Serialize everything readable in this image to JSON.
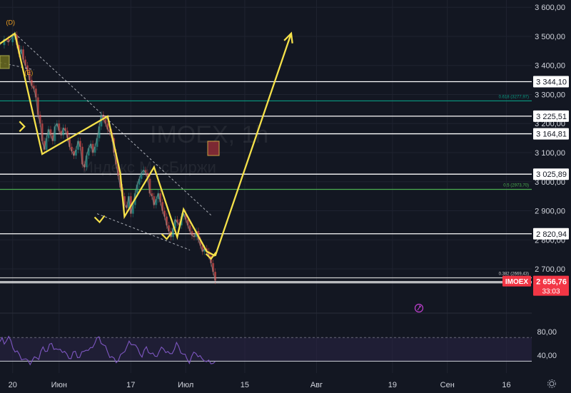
{
  "chart_data": {
    "type": "line",
    "watermark": {
      "ticker": "IMOEX, 1h",
      "name": "Индекс МосБиржи"
    },
    "price_axis": {
      "range": [
        2575,
        3625
      ],
      "ticks": [
        "3 600,00",
        "3 500,00",
        "3 400,00",
        "3 300,00",
        "3 200,00",
        "3 100,00",
        "3 000,00",
        "2 900,00",
        "2 800,00",
        "2 700,00"
      ],
      "tick_values": [
        3600,
        3500,
        3400,
        3300,
        3200,
        3100,
        3000,
        2900,
        2800,
        2700
      ]
    },
    "time_axis": {
      "labels": [
        "20",
        "Июн",
        "17",
        "Июл",
        "15",
        "Авг",
        "19",
        "Сен",
        "16"
      ],
      "label_days": [
        0,
        11,
        28,
        41,
        55,
        72,
        90,
        103,
        117
      ],
      "range_days": [
        -3,
        123
      ]
    },
    "levels": [
      {
        "value": 3344.1,
        "label": "3 344,10"
      },
      {
        "value": 3225.51,
        "label": "3 225,51"
      },
      {
        "value": 3164.81,
        "label": "3 164,81"
      },
      {
        "value": 3025.89,
        "label": "3 025,89"
      },
      {
        "value": 2820.94,
        "label": "2 820,94"
      },
      {
        "value": 2652.44,
        "label": "2 652,44"
      }
    ],
    "fib_levels": [
      {
        "value": 3277.97,
        "label": "0.618 (3277,97)",
        "color": "#089981"
      },
      {
        "value": 2973.7,
        "label": "0.5 (2973,70)",
        "color": "#4caf50"
      },
      {
        "value": 2669.43,
        "label": "0.382 (2669,43)",
        "color": "#cfcfcf"
      }
    ],
    "current_price": {
      "ticker": "IMOEX",
      "value": 2656.76,
      "label": "2 656,76",
      "countdown": "33:03",
      "color": "#f23645"
    },
    "wave_labels": [
      {
        "text": "(D)",
        "day": -0.5,
        "value": 3540
      },
      {
        "text": "(E)",
        "day": 3.8,
        "value": 3368
      }
    ],
    "wave_path": [
      [
        -3,
        3475
      ],
      [
        0.5,
        3510
      ],
      [
        7,
        3095
      ],
      [
        22.5,
        3225
      ],
      [
        25.5,
        3030
      ],
      [
        26.5,
        2880
      ],
      [
        33.5,
        3050
      ],
      [
        39,
        2810
      ],
      [
        40.5,
        2905
      ],
      [
        46,
        2760
      ],
      [
        48,
        2745
      ]
    ],
    "projection_path": [
      [
        48,
        2745
      ],
      [
        66,
        3510
      ]
    ],
    "trend_lines": [
      {
        "from": [
          0.5,
          3510
        ],
        "to": [
          47,
          2885
        ]
      },
      {
        "from": [
          20,
          2890
        ],
        "to": [
          42,
          2765
        ]
      },
      {
        "from": [
          -3,
          3410
        ],
        "to": [
          5,
          3385
        ]
      }
    ],
    "close_series": {
      "days": [
        -3,
        -2,
        -1,
        0,
        0.5,
        1,
        1.5,
        2,
        2.5,
        3,
        3.5,
        4,
        4.5,
        5,
        5.5,
        6,
        6.5,
        7,
        7.5,
        8,
        8.5,
        9,
        9.5,
        10,
        10.5,
        11,
        11.5,
        12,
        12.5,
        13,
        13.5,
        14,
        14.5,
        15,
        15.5,
        16,
        16.5,
        17,
        17.5,
        18,
        18.5,
        19,
        19.5,
        20,
        20.5,
        21,
        21.5,
        22,
        22.5,
        23,
        23.5,
        24,
        24.5,
        25,
        25.5,
        26,
        26.5,
        27,
        27.5,
        28,
        28.5,
        29,
        29.5,
        30,
        30.5,
        31,
        31.5,
        32,
        32.5,
        33,
        33.5,
        34,
        34.5,
        35,
        35.5,
        36,
        36.5,
        37,
        37.5,
        38,
        38.5,
        39,
        39.5,
        40,
        40.5,
        41,
        41.5,
        42,
        42.5,
        43,
        43.5,
        44,
        44.5,
        45,
        45.5,
        46,
        46.5,
        47,
        47.5,
        48
      ],
      "values": [
        3470,
        3490,
        3480,
        3500,
        3505,
        3470,
        3440,
        3455,
        3420,
        3400,
        3380,
        3350,
        3330,
        3320,
        3290,
        3230,
        3200,
        3140,
        3110,
        3150,
        3180,
        3160,
        3140,
        3190,
        3200,
        3175,
        3160,
        3185,
        3175,
        3150,
        3120,
        3105,
        3090,
        3110,
        3140,
        3120,
        3060,
        3050,
        3090,
        3115,
        3130,
        3100,
        3120,
        3150,
        3190,
        3230,
        3215,
        3200,
        3180,
        3170,
        3150,
        3100,
        3060,
        3020,
        2980,
        2950,
        2920,
        2910,
        2950,
        2890,
        2920,
        2960,
        2990,
        3010,
        3030,
        3040,
        3030,
        3010,
        2960,
        2950,
        2920,
        2940,
        2960,
        2930,
        2900,
        2880,
        2850,
        2830,
        2810,
        2840,
        2870,
        2860,
        2850,
        2880,
        2890,
        2870,
        2850,
        2830,
        2815,
        2810,
        2830,
        2800,
        2780,
        2760,
        2770,
        2760,
        2745,
        2720,
        2690,
        2660,
        2657
      ]
    },
    "rsi": {
      "ticks": [
        "80,00",
        "40,00"
      ],
      "tick_values": [
        80,
        40
      ],
      "upper": 70,
      "lower": 30,
      "range": [
        10,
        92
      ],
      "values": [
        63,
        66,
        60,
        68,
        70,
        62,
        55,
        48,
        44,
        40,
        36,
        34,
        30,
        32,
        28,
        30,
        34,
        38,
        36,
        44,
        52,
        50,
        48,
        55,
        60,
        54,
        50,
        46,
        52,
        48,
        44,
        40,
        38,
        36,
        42,
        46,
        40,
        36,
        42,
        48,
        52,
        46,
        50,
        56,
        62,
        66,
        70,
        64,
        58,
        52,
        46,
        40,
        36,
        32,
        30,
        34,
        38,
        42,
        50,
        56,
        60,
        58,
        62,
        56,
        48,
        44,
        40,
        46,
        52,
        48,
        44,
        40,
        38,
        42,
        46,
        50,
        52,
        48,
        44,
        40,
        46,
        52,
        58,
        54,
        48,
        42,
        38,
        34,
        30,
        36,
        42,
        46,
        40,
        36,
        32,
        34,
        30,
        28,
        26,
        30,
        28
      ]
    },
    "colors": {
      "background": "#131722",
      "grid": "#1f2330",
      "price_line": "#8a9a96",
      "wave": "#f5e14a",
      "rsi_line": "#7e57c2",
      "rsi_band": "#2a2545",
      "axis_text": "#d1d4dc",
      "level_line": "#ffffff",
      "order_box": "#6b6b1f",
      "order_box_red": "#a0303a"
    }
  }
}
